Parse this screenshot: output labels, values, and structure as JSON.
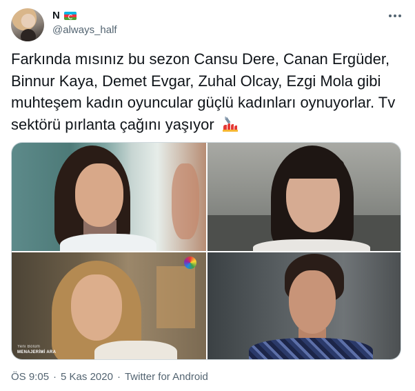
{
  "author": {
    "display_name": "N",
    "handle": "@always_half",
    "flag": "azerbaijan-flag-icon"
  },
  "tweet": {
    "text": "Farkında mısınız bu sezon Cansu Dere, Canan Ergüder, Binnur Kaya, Demet Evgar, Zuhal Olcay, Ezgi Mola gibi muhteşem kadın oyuncular güçlü kadınları oynuyorlar. Tv sektörü pırlanta çağını yaşıyor",
    "emoji": "nail-polish-icon"
  },
  "media": {
    "photo3_caption_small": "Yeni Bölüm",
    "photo3_caption_title": "MENAJERİMİ ARA"
  },
  "footer": {
    "time": "ÖS 9:05",
    "separator": "·",
    "date": "5 Kas 2020",
    "source": "Twitter for Android"
  },
  "colors": {
    "text": "#0f1419",
    "secondary": "#536471",
    "border": "#cfd9de"
  }
}
